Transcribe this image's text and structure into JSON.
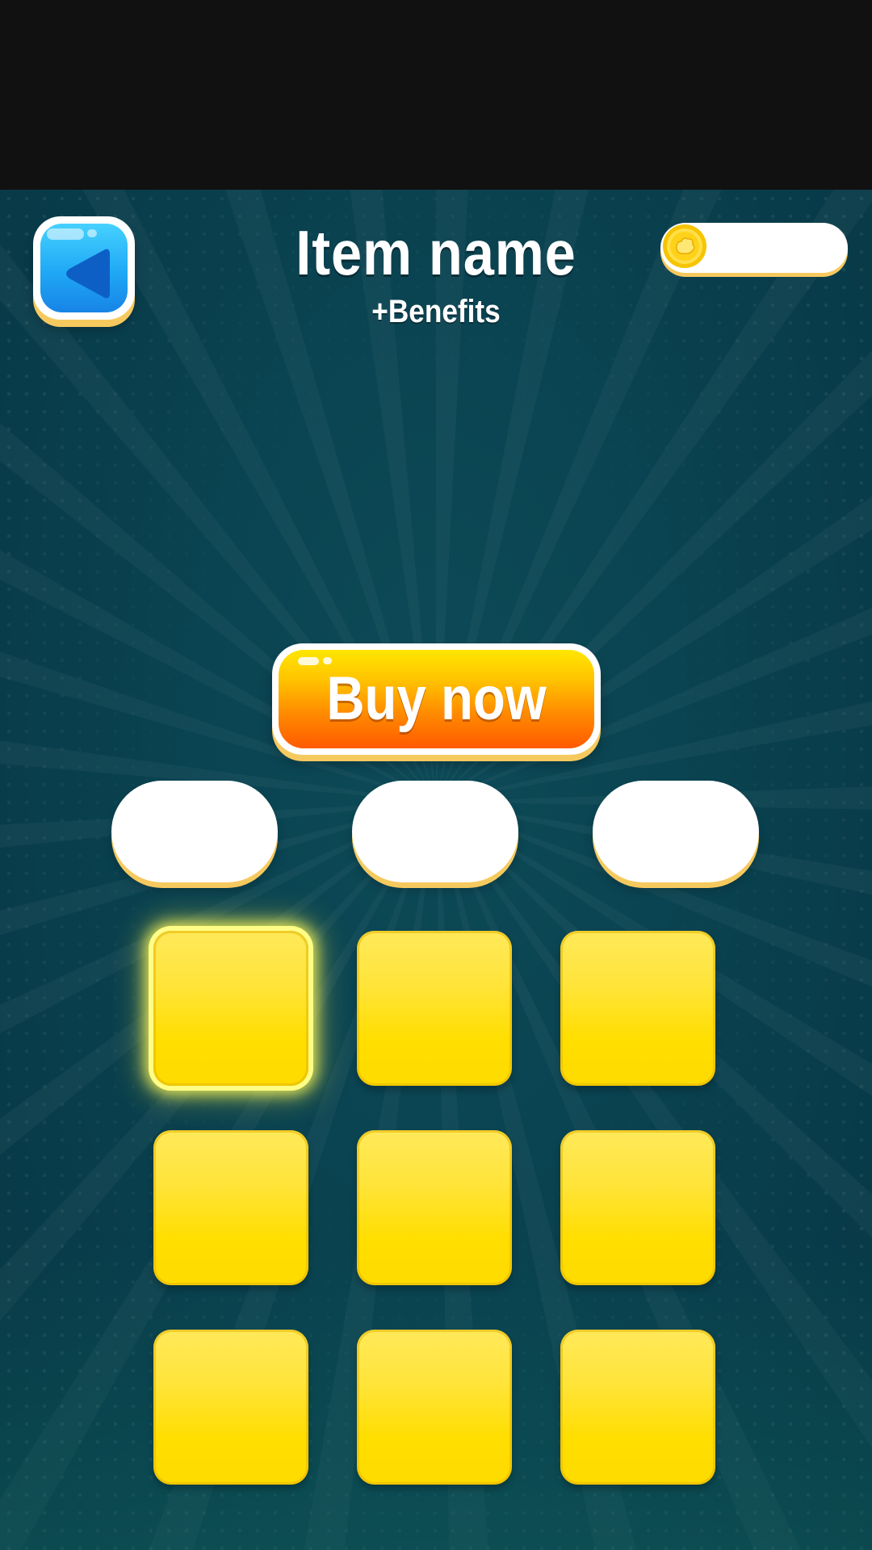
{
  "header": {
    "title": "Item name",
    "subtitle": "+Benefits",
    "back_icon": "back-arrow-icon",
    "coin_icon": "coin-icon",
    "coin_value": ""
  },
  "buy_button": {
    "label": "Buy now"
  },
  "options": [
    {
      "label": ""
    },
    {
      "label": ""
    },
    {
      "label": ""
    }
  ],
  "grid": {
    "rows": 3,
    "columns": 3,
    "selected_index": 0
  },
  "colors": {
    "background": "#0a4250",
    "accent_yellow": "#ffde00",
    "button_orange": "#ff7a00",
    "back_button_blue": "#1fa8f5",
    "trim_gold": "#f6c95f"
  }
}
